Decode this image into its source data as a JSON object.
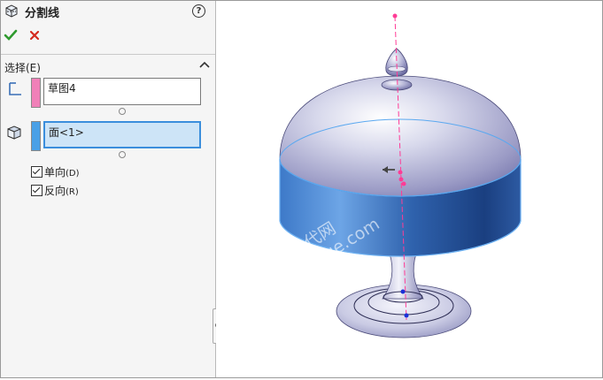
{
  "panel": {
    "title": "分割线",
    "help_symbol": "?",
    "ok_icon": "checkmark-icon",
    "cancel_icon": "x-icon",
    "section_title": "选择(E)",
    "selections": [
      {
        "icon": "sketch-icon",
        "swatch_color": "#f080b8",
        "value": "草图4",
        "active": false
      },
      {
        "icon": "face-icon",
        "swatch_color": "#4aa0e6",
        "value": "面<1>",
        "active": true
      }
    ],
    "options": [
      {
        "label": "单向",
        "shortcut": "(D)",
        "checked": true
      },
      {
        "label": "反向",
        "shortcut": "(R)",
        "checked": true
      }
    ]
  },
  "viewport": {
    "model": "dome-cover-model",
    "watermark_line1": "机械时代网",
    "watermark_line2": "www.jxage.com"
  },
  "colors": {
    "panel_bg": "#f5f5f5",
    "accent_blue": "#3b8edc",
    "selected_face": "#3e7fd0",
    "sketch_line": "#ff3c96"
  }
}
